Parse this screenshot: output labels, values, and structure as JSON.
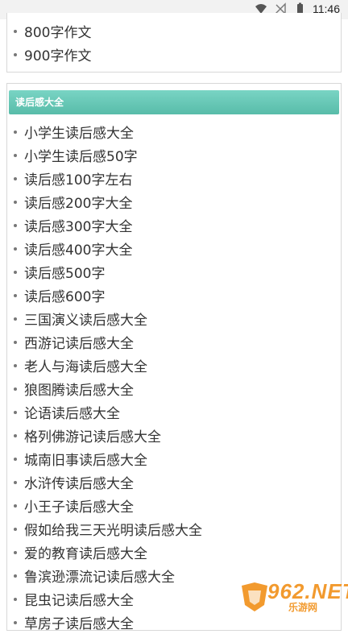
{
  "status_bar": {
    "time": "11:46",
    "icons": [
      "wifi-icon",
      "no-signal-icon",
      "battery-icon"
    ]
  },
  "top_list": {
    "items": [
      "800字作文",
      "900字作文"
    ]
  },
  "section": {
    "title": "读后感大全",
    "header_color": "#5fc2b0",
    "items": [
      "小学生读后感大全",
      "小学生读后感50字",
      "读后感100字左右",
      "读后感200字大全",
      "读后感300字大全",
      "读后感400字大全",
      "读后感500字",
      "读后感600字",
      "三国演义读后感大全",
      "西游记读后感大全",
      "老人与海读后感大全",
      "狼图腾读后感大全",
      "论语读后感大全",
      "格列佛游记读后感大全",
      "城南旧事读后感大全",
      "水浒传读后感大全",
      "小王子读后感大全",
      "假如给我三天光明读后感大全",
      "爱的教育读后感大全",
      "鲁滨逊漂流记读后感大全",
      "昆虫记读后感大全",
      "草房子读后感大全"
    ]
  },
  "watermark": {
    "number": "962.NET",
    "subtitle": "乐游网"
  }
}
